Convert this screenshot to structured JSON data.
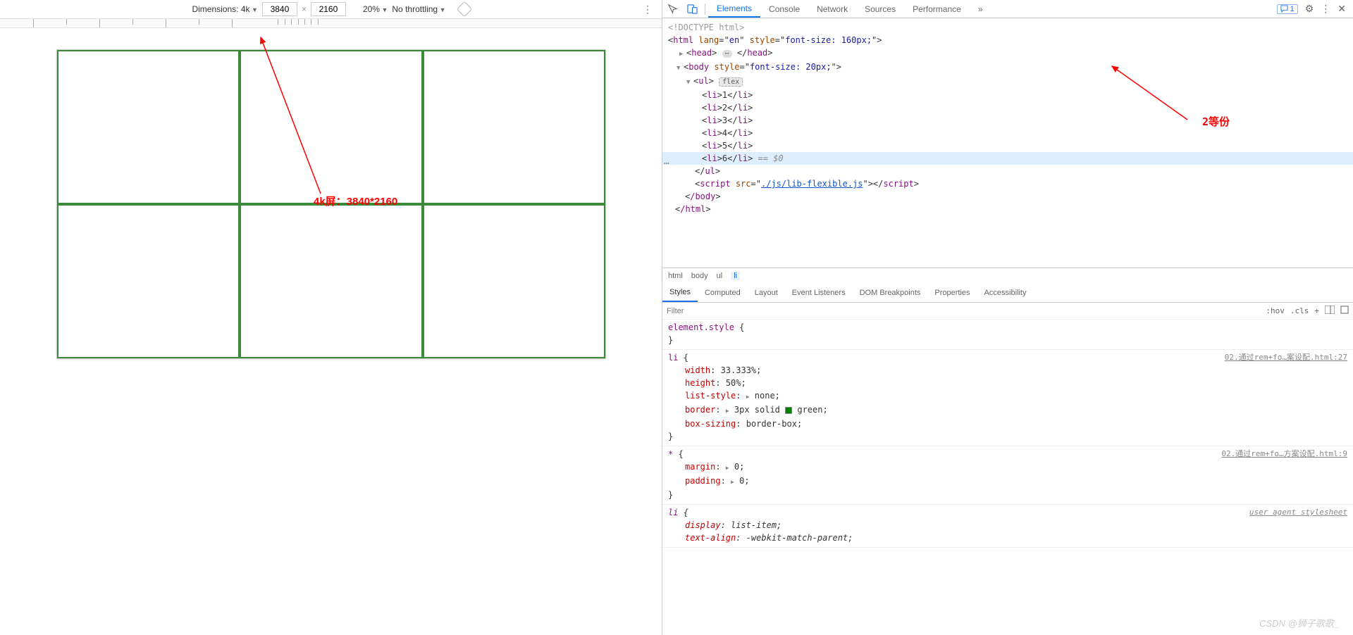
{
  "toolbar": {
    "dimensions_label": "Dimensions: 4k",
    "width_value": "3840",
    "height_value": "2160",
    "zoom_label": "20%",
    "throttle_label": "No throttling"
  },
  "annotations": {
    "text1": "4k屏：3840*2160",
    "text2": "2等份"
  },
  "devtools": {
    "tabs": [
      "Elements",
      "Console",
      "Network",
      "Sources",
      "Performance"
    ],
    "active_tab": "Elements",
    "msg_count": "1"
  },
  "dom": {
    "doctype": "<!DOCTYPE html>",
    "html_open": "html",
    "html_lang_attr": "lang",
    "html_lang_val": "en",
    "html_style_attr": "style",
    "html_style_val": "font-size: 160px;",
    "head_label": "head",
    "body_label": "body",
    "body_style_attr": "style",
    "body_style_val": "font-size: 20px;",
    "ul_label": "ul",
    "flex_badge": "flex",
    "li_items": [
      "1",
      "2",
      "3",
      "4",
      "5",
      "6"
    ],
    "selected_comment": " == $0",
    "script_label": "script",
    "script_src_attr": "src",
    "script_src_val": "./js/lib-flexible.js",
    "body_close": "/body",
    "html_close": "/html"
  },
  "breadcrumb": [
    "html",
    "body",
    "ul",
    "li"
  ],
  "styles_tabs": [
    "Styles",
    "Computed",
    "Layout",
    "Event Listeners",
    "DOM Breakpoints",
    "Properties",
    "Accessibility"
  ],
  "filter_placeholder": "Filter",
  "filter_btns": {
    "hov": ":hov",
    "cls": ".cls"
  },
  "styles": {
    "element_style_sel": "element.style",
    "li_selector": "li",
    "li_src": "02.通过rem+fo…案设配.html:27",
    "li_props": {
      "width": {
        "name": "width",
        "val": "33.333%;"
      },
      "height": {
        "name": "height",
        "val": "50%;"
      },
      "list_style": {
        "name": "list-style",
        "val": "none;"
      },
      "border": {
        "name": "border",
        "val_pre": "3px solid ",
        "val_post": "green;"
      },
      "box_sizing": {
        "name": "box-sizing",
        "val": "border-box;"
      }
    },
    "star_selector": "*",
    "star_src": "02.通过rem+fo…方案设配.html:9",
    "star_props": {
      "margin": {
        "name": "margin",
        "val": "0;"
      },
      "padding": {
        "name": "padding",
        "val": "0;"
      }
    },
    "ua_label": "user agent stylesheet",
    "ua_selector": "li",
    "ua_props": {
      "display": {
        "name": "display",
        "val": "list-item;"
      },
      "text_align": {
        "name": "text-align",
        "val": "-webkit-match-parent;"
      }
    }
  },
  "watermark": "CSDN @狮子歌歌_"
}
